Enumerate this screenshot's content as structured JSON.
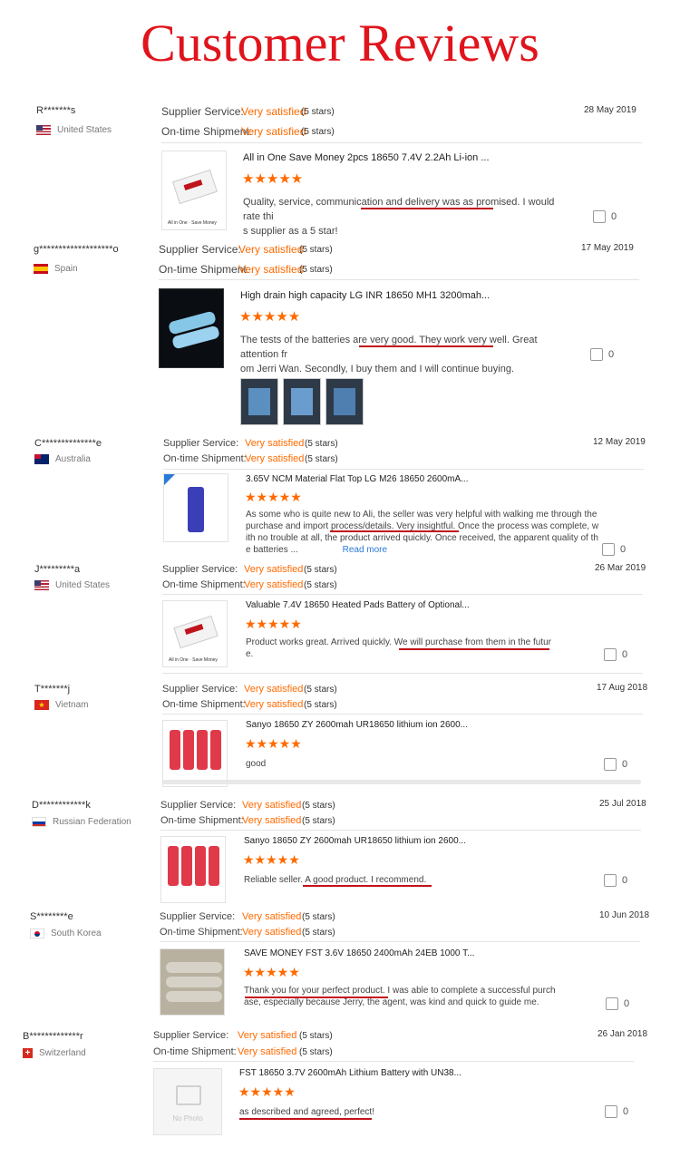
{
  "heading": "Customer Reviews",
  "labels": {
    "supplier_service": "Supplier Service:",
    "on_time_shipment": "On-time Shipment:",
    "read_more": "Read more",
    "no_photo": "No Photo"
  },
  "reviews": [
    {
      "user": "R*******s",
      "country": "United States",
      "date": "28 May 2019",
      "supplier_value": "Very satisfied",
      "supplier_stars": "(5 stars)",
      "shipment_value": "Very satisfied",
      "shipment_stars": "(5 stars)",
      "product": "All in One Save Money 2pcs 18650 7.4V 2.2Ah Li-ion ...",
      "rating": 5,
      "text_line1": "Quality, service, communication and delivery was as promised.  I would rate thi",
      "text_line2": "s supplier as a 5 star!",
      "likes": "0"
    },
    {
      "user": "g*******************o",
      "country": "Spain",
      "date": "17 May 2019",
      "supplier_value": "Very satisfied",
      "supplier_stars": "(5 stars)",
      "shipment_value": "Very satisfied",
      "shipment_stars": "(5 stars)",
      "product": "High drain high capacity LG INR 18650 MH1 3200mah...",
      "rating": 5,
      "text_line1": "The tests of the batteries are very good. They work very well. Great attention fr",
      "text_line2": "om Jerri Wan. Secondly, I buy them and I will continue buying.",
      "likes": "0"
    },
    {
      "user": "C**************e",
      "country": "Australia",
      "date": "12 May 2019",
      "supplier_value": "Very satisfied",
      "supplier_stars": "(5 stars)",
      "shipment_value": "Very satisfied",
      "shipment_stars": "(5 stars)",
      "product": "3.65V NCM Material Flat Top LG M26 18650 2600mA...",
      "rating": 5,
      "text_line1": "As some who is quite new to Ali, the seller was very helpful with walking me through the",
      "text_line2": "purchase and import process/details. Very insightful. Once the process was complete, w",
      "text_line3": "ith no trouble at all, the product arrived quickly. Once received, the apparent quality of th",
      "text_line4": "e batteries ...",
      "likes": "0"
    },
    {
      "user": "J*********a",
      "country": "United States",
      "date": "26 Mar 2019",
      "supplier_value": "Very satisfied",
      "supplier_stars": "(5 stars)",
      "shipment_value": "Very satisfied",
      "shipment_stars": "(5 stars)",
      "product": "Valuable 7.4V 18650 Heated Pads Battery of Optional...",
      "rating": 5,
      "text_line1": "Product works great.  Arrived quickly.  We will purchase from them in the futur",
      "text_line2": "e.",
      "likes": "0"
    },
    {
      "user": "T*******j",
      "country": "Vietnam",
      "date": "17 Aug 2018",
      "supplier_value": "Very satisfied",
      "supplier_stars": "(5 stars)",
      "shipment_value": "Very satisfied",
      "shipment_stars": "(5 stars)",
      "product": "Sanyo 18650 ZY 2600mah UR18650 lithium ion 2600...",
      "rating": 5,
      "text_line1": "good",
      "likes": "0"
    },
    {
      "user": "D************k",
      "country": "Russian Federation",
      "date": "25 Jul 2018",
      "supplier_value": "Very satisfied",
      "supplier_stars": "(5 stars)",
      "shipment_value": "Very satisfied",
      "shipment_stars": "(5 stars)",
      "product": "Sanyo 18650 ZY 2600mah UR18650 lithium ion 2600...",
      "rating": 5,
      "text_line1": "Reliable seller. A good product. I recommend.",
      "likes": "0"
    },
    {
      "user": "S********e",
      "country": "South Korea",
      "date": "10 Jun 2018",
      "supplier_value": "Very satisfied",
      "supplier_stars": "(5 stars)",
      "shipment_value": "Very satisfied",
      "shipment_stars": "(5 stars)",
      "product": "SAVE MONEY FST 3.6V 18650 2400mAh 24EB 1000 T...",
      "rating": 5,
      "text_line1": "Thank you for your perfect product. I was able to complete a successful purch",
      "text_line2": "ase, especially because Jerry, the agent, was kind and quick to guide me.",
      "likes": "0"
    },
    {
      "user": "B*************r",
      "country": "Switzerland",
      "date": "26 Jan 2018",
      "supplier_value": "Very satisfied",
      "supplier_stars": "(5 stars)",
      "shipment_value": "Very satisfied",
      "shipment_stars": "(5 stars)",
      "product": "FST 18650 3.7V 2600mAh Lithium Battery with UN38...",
      "rating": 5,
      "text_line1": "as described and agreed, perfect!",
      "likes": "0"
    }
  ]
}
